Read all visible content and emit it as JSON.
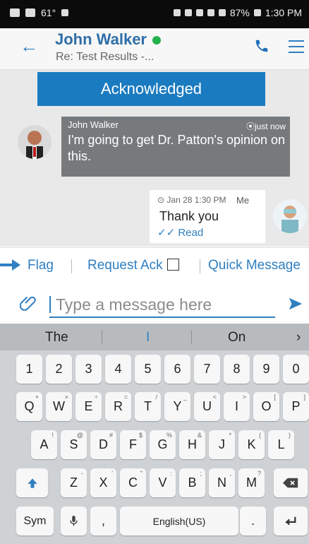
{
  "status_bar": {
    "temperature": "61°",
    "battery": "87%",
    "time": "1:30 PM"
  },
  "header": {
    "back_icon": "back-arrow-icon",
    "contact_name": "John Walker",
    "subject": "Re: Test Results -...",
    "online_color": "#22b14c",
    "call_icon": "phone-icon",
    "menu_icon": "hamburger-icon"
  },
  "chat": {
    "acknowledged_label": "Acknowledged",
    "incoming": {
      "sender": "John Walker",
      "time": "⦿just now",
      "text": "I'm going to get Dr. Patton's opinion on this."
    },
    "outgoing": {
      "date": "Jan 28 1:30 PM",
      "sender": "Me",
      "text": "Thank you",
      "status": "Read"
    }
  },
  "action_bar": {
    "flag": "Flag",
    "request_ack": "Request Ack",
    "quick_message": "Quick Message"
  },
  "composer": {
    "placeholder": "Type a message here"
  },
  "keyboard": {
    "suggestions": [
      "The",
      "I",
      "On"
    ],
    "number_row": [
      "1",
      "2",
      "3",
      "4",
      "5",
      "6",
      "7",
      "8",
      "9",
      "0"
    ],
    "row1": [
      "Q",
      "W",
      "E",
      "R",
      "T",
      "Y",
      "U",
      "I",
      "O",
      "P"
    ],
    "row1_small": [
      "+",
      "×",
      "÷",
      "=",
      "/",
      "_",
      "<",
      ">",
      "[",
      "]"
    ],
    "row2": [
      "A",
      "S",
      "D",
      "F",
      "G",
      "H",
      "J",
      "K",
      "L"
    ],
    "row2_small": [
      "!",
      "@",
      "#",
      "$",
      "%",
      "&",
      "*",
      "(",
      ")"
    ],
    "row3": [
      "Z",
      "X",
      "C",
      "V",
      "B",
      "N",
      "M"
    ],
    "row3_small": [
      "-",
      "'",
      "\"",
      ":",
      ";",
      ",",
      "?"
    ],
    "sym_label": "Sym",
    "comma": ",",
    "space_label": "English(US)",
    "period": "."
  }
}
